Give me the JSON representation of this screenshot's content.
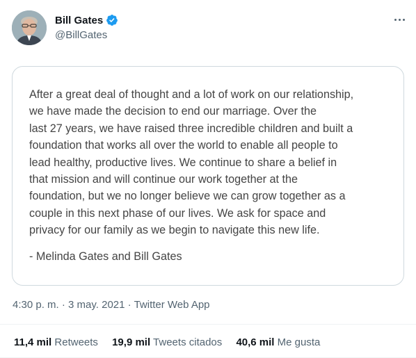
{
  "author": {
    "display_name": "Bill Gates",
    "handle": "@BillGates",
    "verified": true,
    "verified_color": "#1d9bf0"
  },
  "statement": {
    "lines": [
      "After a great deal of thought and a lot of work on our relationship,",
      "we have made the decision to end our marriage. Over the",
      "last 27 years, we have raised three incredible children and built a",
      "foundation that works all over the world to enable all people to",
      "lead healthy, productive lives. We continue to share a belief in",
      "that mission and will continue our work together at the",
      "foundation, but we no longer believe we can grow together as a",
      "couple in this next phase of our lives. We ask for space and",
      "privacy for our family as we begin to navigate this new life."
    ],
    "signature": "- Melinda Gates and Bill Gates"
  },
  "meta": {
    "time": "4:30 p. m.",
    "separator": "·",
    "date": "3 may. 2021",
    "source": "Twitter Web App"
  },
  "stats": {
    "retweets": {
      "count": "11,4 mil",
      "label": "Retweets"
    },
    "quotes": {
      "count": "19,9 mil",
      "label": "Tweets citados"
    },
    "likes": {
      "count": "40,6 mil",
      "label": "Me gusta"
    }
  },
  "icons": {
    "more": "more-options-icon",
    "verified": "verified-badge-icon"
  }
}
